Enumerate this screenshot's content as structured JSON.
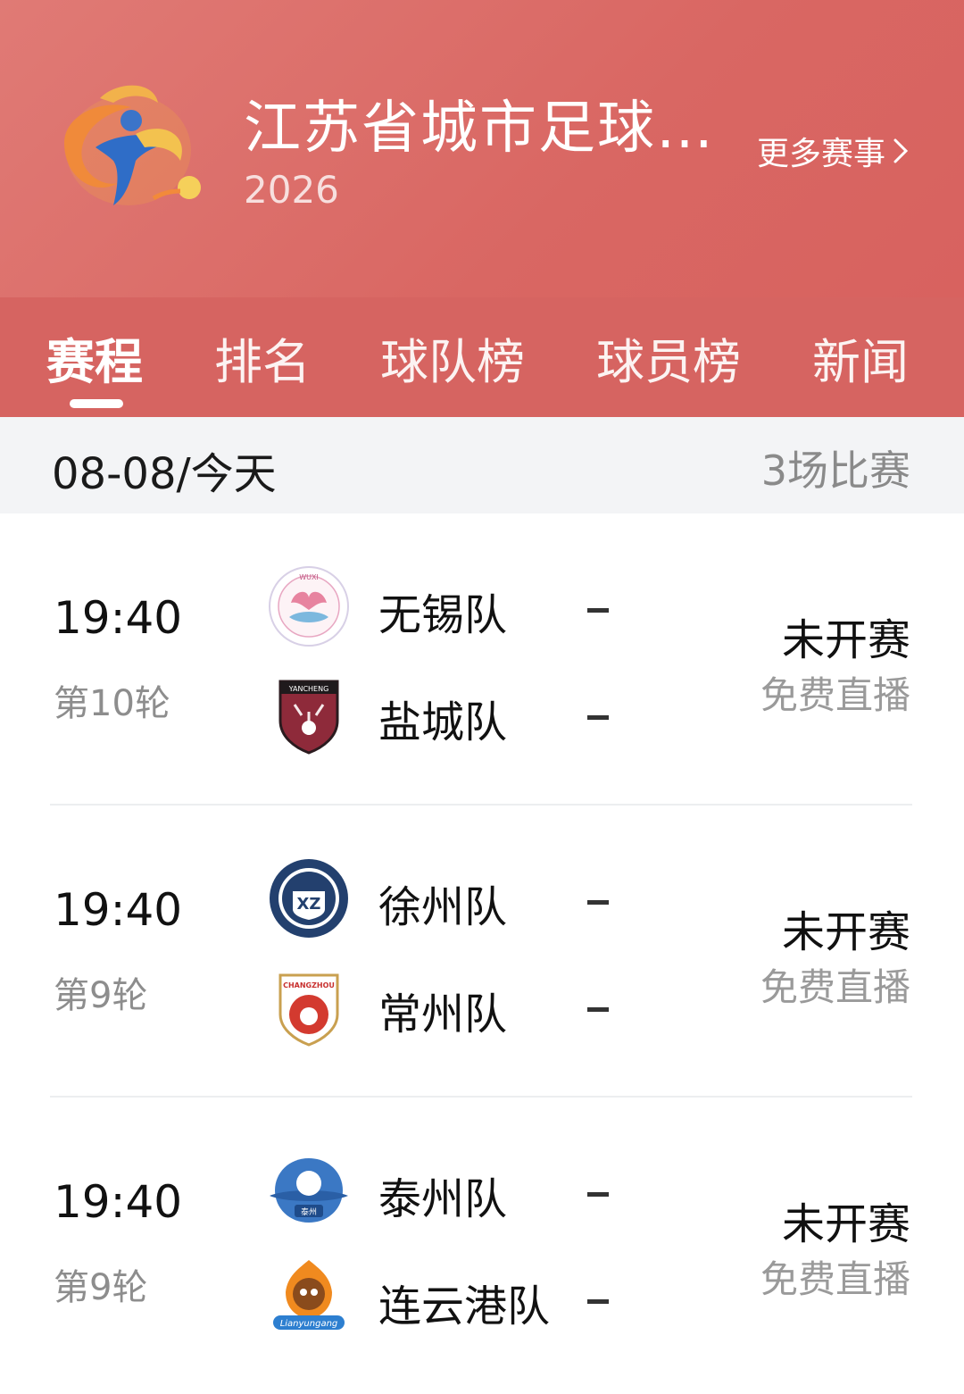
{
  "header": {
    "title": "江苏省城市足球…",
    "season": "2026",
    "more_label": "更多赛事"
  },
  "tabs": [
    {
      "label": "赛程",
      "active": true
    },
    {
      "label": "排名",
      "active": false
    },
    {
      "label": "球队榜",
      "active": false
    },
    {
      "label": "球员榜",
      "active": false
    },
    {
      "label": "新闻",
      "active": false
    }
  ],
  "date_bar": {
    "date": "08-08/今天",
    "count": "3场比赛"
  },
  "matches": [
    {
      "time": "19:40",
      "round": "第10轮",
      "home": {
        "name": "无锡队",
        "score": "-"
      },
      "away": {
        "name": "盐城队",
        "score": "-"
      },
      "status": "未开赛",
      "broadcast": "免费直播"
    },
    {
      "time": "19:40",
      "round": "第9轮",
      "home": {
        "name": "徐州队",
        "score": "-"
      },
      "away": {
        "name": "常州队",
        "score": "-"
      },
      "status": "未开赛",
      "broadcast": "免费直播"
    },
    {
      "time": "19:40",
      "round": "第9轮",
      "home": {
        "name": "泰州队",
        "score": "-"
      },
      "away": {
        "name": "连云港队",
        "score": "-"
      },
      "status": "未开赛",
      "broadcast": "免费直播"
    }
  ],
  "badges": {
    "wuxi_text": "WUXI",
    "yancheng_text": "YANCHENG",
    "xuzhou_text": "XZ",
    "changzhou_text": "CHANGZHOU",
    "taizhou_text": "泰州",
    "lianyungang_text": "Lianyungang"
  },
  "colors": {
    "header": "#dd6f6b",
    "tabbar": "#d66461",
    "dateband": "#f3f4f6"
  }
}
